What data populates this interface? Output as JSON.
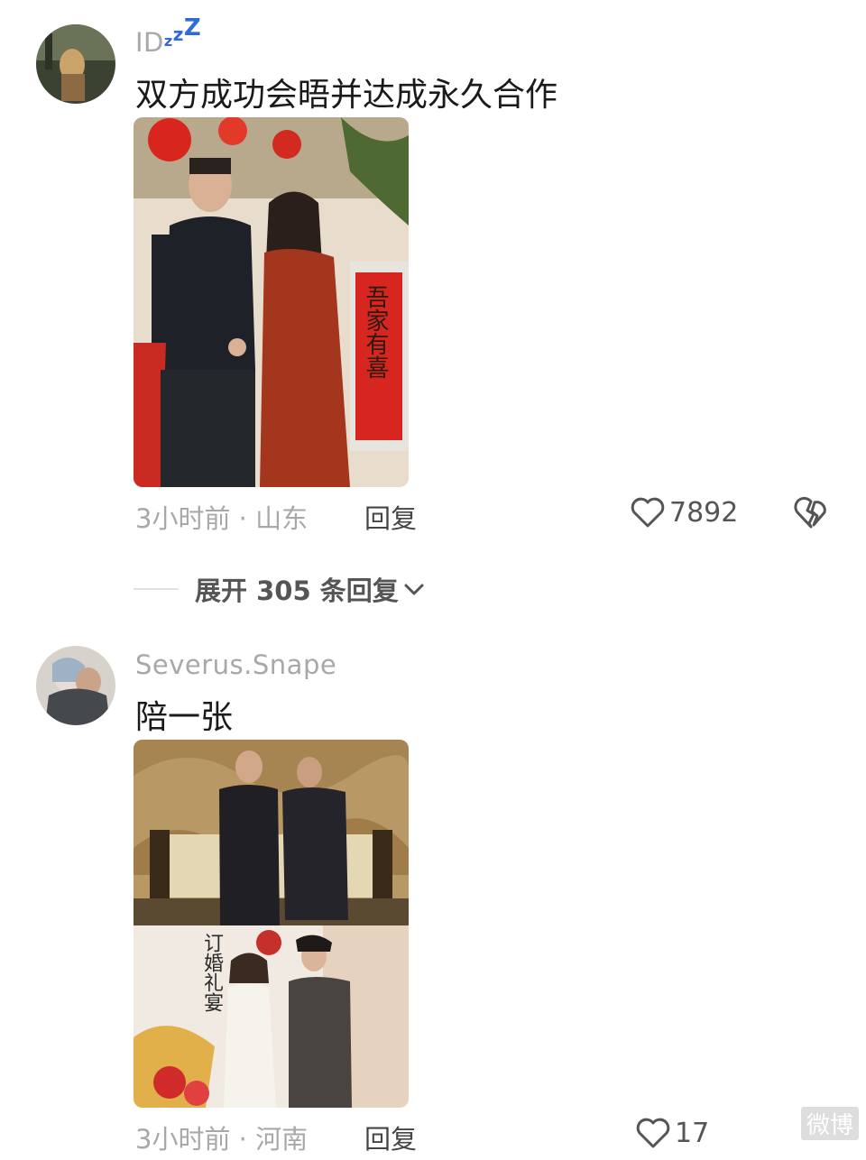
{
  "comments": [
    {
      "username": "ID",
      "username_suffix": "zzZ",
      "text": "双方成功会晤并达成永久合作",
      "photo_caption": "吾家有喜",
      "time": "3小时前",
      "location": "山东",
      "reply_label": "回复",
      "likes": "7892",
      "expand_label": "展开 305 条回复"
    },
    {
      "username": "Severus.Snape",
      "text": "陪一张",
      "photo_caption_left": "订婚礼宴",
      "time": "3小时前",
      "location": "河南",
      "reply_label": "回复",
      "likes": "17"
    }
  ],
  "watermark": "微博"
}
